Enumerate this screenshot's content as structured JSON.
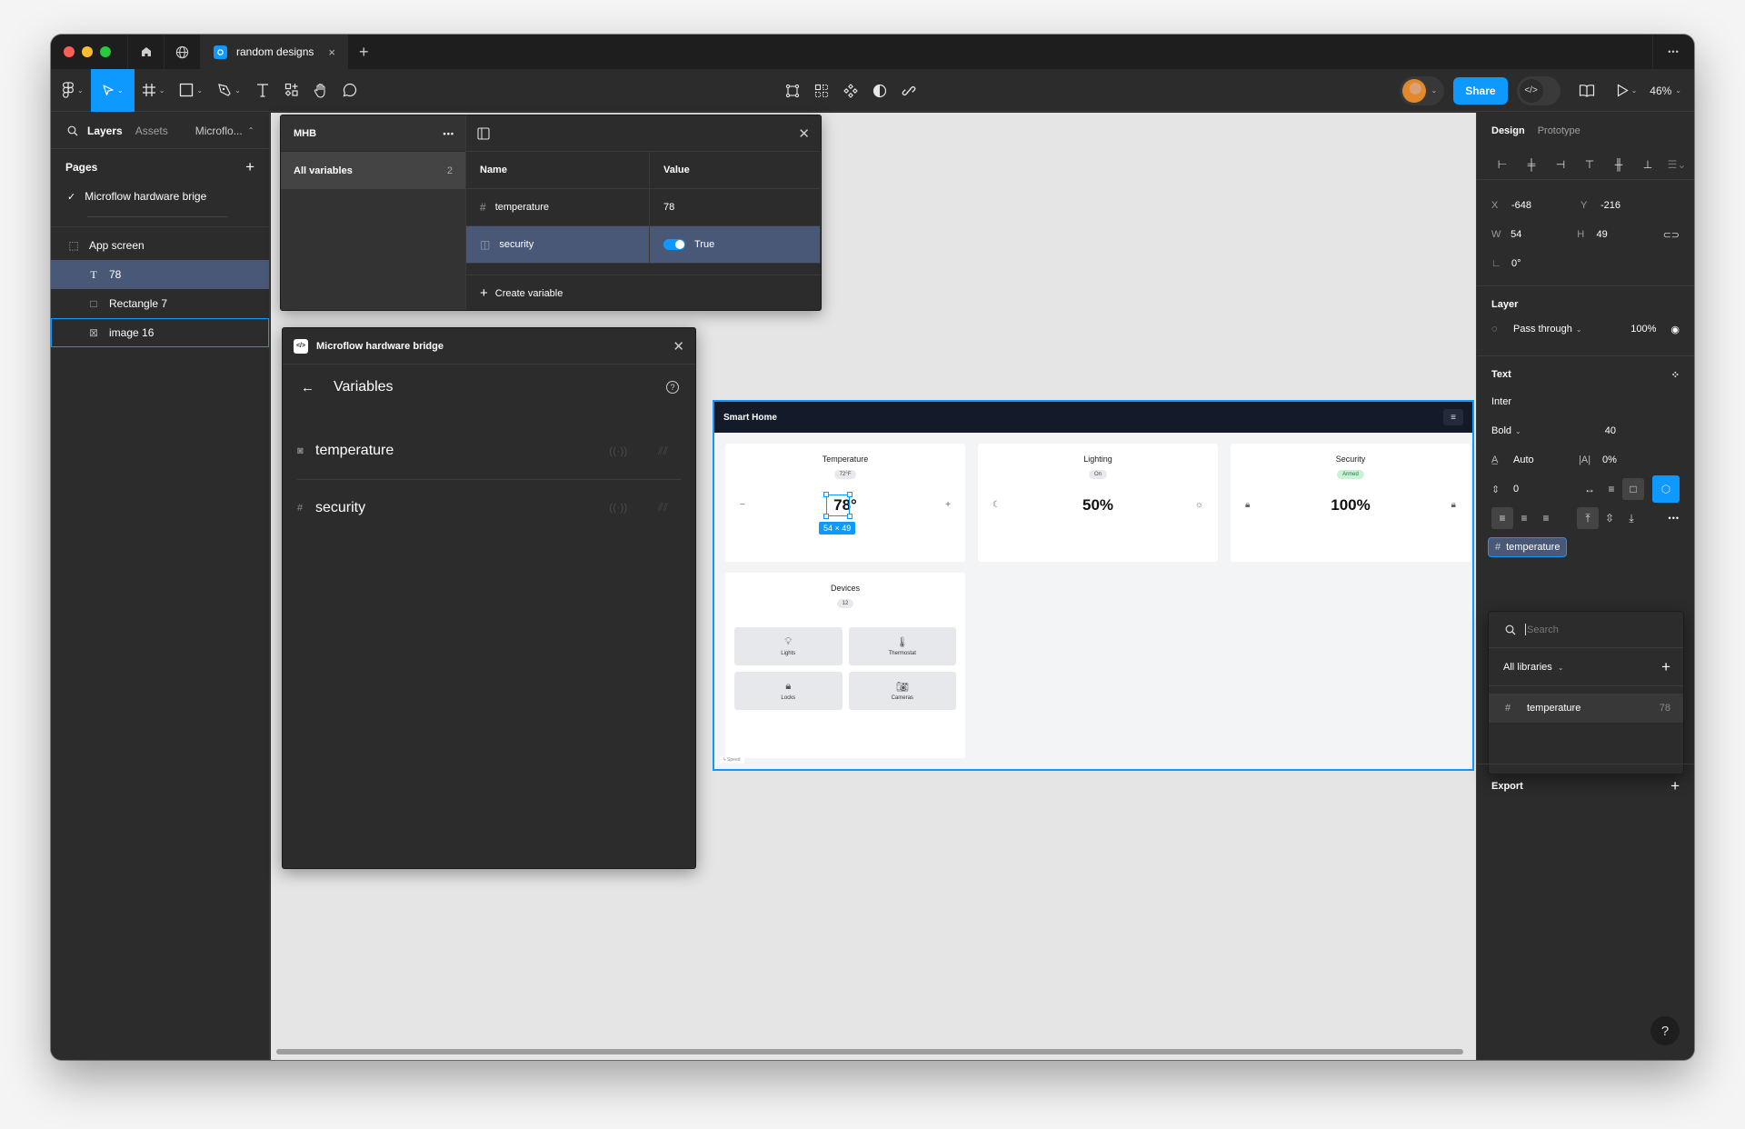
{
  "titlebar": {
    "tab_title": "random designs",
    "close_glyph": "×",
    "new_tab_glyph": "+",
    "more_glyph": "•••"
  },
  "toolbar": {
    "share_label": "Share",
    "zoom_level": "46%",
    "dev_mode_glyph": "</>"
  },
  "left_panel": {
    "tabs": [
      "Layers",
      "Assets",
      "Microflo..."
    ],
    "pages_header": "Pages",
    "pages": [
      {
        "label": "Microflow hardware brige",
        "current": true
      }
    ],
    "layers": [
      {
        "label": "App screen",
        "icon": "frame-icon",
        "glyph": "⬚"
      },
      {
        "label": "78",
        "icon": "text-icon",
        "glyph": "T",
        "selected": true
      },
      {
        "label": "Rectangle 7",
        "icon": "rectangle-icon",
        "glyph": "□"
      },
      {
        "label": "image 16",
        "icon": "image-icon",
        "glyph": "⊠",
        "hovered": true
      }
    ]
  },
  "variables_modal": {
    "collection": "MHB",
    "all_variables_label": "All variables",
    "all_variables_count": "2",
    "columns": [
      "Name",
      "Value"
    ],
    "rows": [
      {
        "type_glyph": "#",
        "name": "temperature",
        "value": "78"
      },
      {
        "type_glyph": "◫",
        "name": "security",
        "value": "True",
        "toggle_on": true,
        "selected": true
      }
    ],
    "create_label": "Create variable"
  },
  "plugin": {
    "title": "Microflow hardware bridge",
    "logo_glyph": "</>",
    "section_title": "Variables",
    "variables": [
      {
        "type_glyph": "◙",
        "name": "temperature"
      },
      {
        "type_glyph": "#",
        "name": "security"
      }
    ]
  },
  "app_screen": {
    "header_title": "Smart Home",
    "cards": [
      {
        "title": "Temperature",
        "badge": "72°F",
        "value": "78°",
        "left_icon": "−",
        "right_icon": "+"
      },
      {
        "title": "Lighting",
        "badge": "On",
        "value": "50%",
        "left_icon": "☾",
        "right_icon": "☼"
      },
      {
        "title": "Security",
        "badge": "Armed",
        "value": "100%",
        "left_icon": "🔒︎",
        "right_icon": "🔒︎"
      }
    ],
    "selection_dimensions": "54 × 49",
    "devices": {
      "title": "Devices",
      "count": "12",
      "items": [
        {
          "label": "Lights",
          "glyph": "💡︎"
        },
        {
          "label": "Thermostat",
          "glyph": "🌡︎"
        },
        {
          "label": "Locks",
          "glyph": "🔒︎"
        },
        {
          "label": "Cameras",
          "glyph": "📷︎"
        }
      ]
    },
    "speed_label": "Speed"
  },
  "right_panel": {
    "tabs": [
      "Design",
      "Prototype"
    ],
    "x": "-648",
    "y": "-216",
    "w": "54",
    "h": "49",
    "rotation": "0°",
    "layer_header": "Layer",
    "blend_mode": "Pass through",
    "opacity": "100%",
    "text_header": "Text",
    "font_family": "Inter",
    "font_weight": "Bold",
    "font_size": "40",
    "line_height": "Auto",
    "letter_spacing": "0%",
    "paragraph_spacing": "0",
    "bound_variable": "temperature",
    "dropdown": {
      "search_placeholder": "Search",
      "library_filter": "All libraries",
      "items": [
        {
          "name": "temperature",
          "value": "78"
        }
      ]
    },
    "export_header": "Export"
  },
  "help_glyph": "?"
}
